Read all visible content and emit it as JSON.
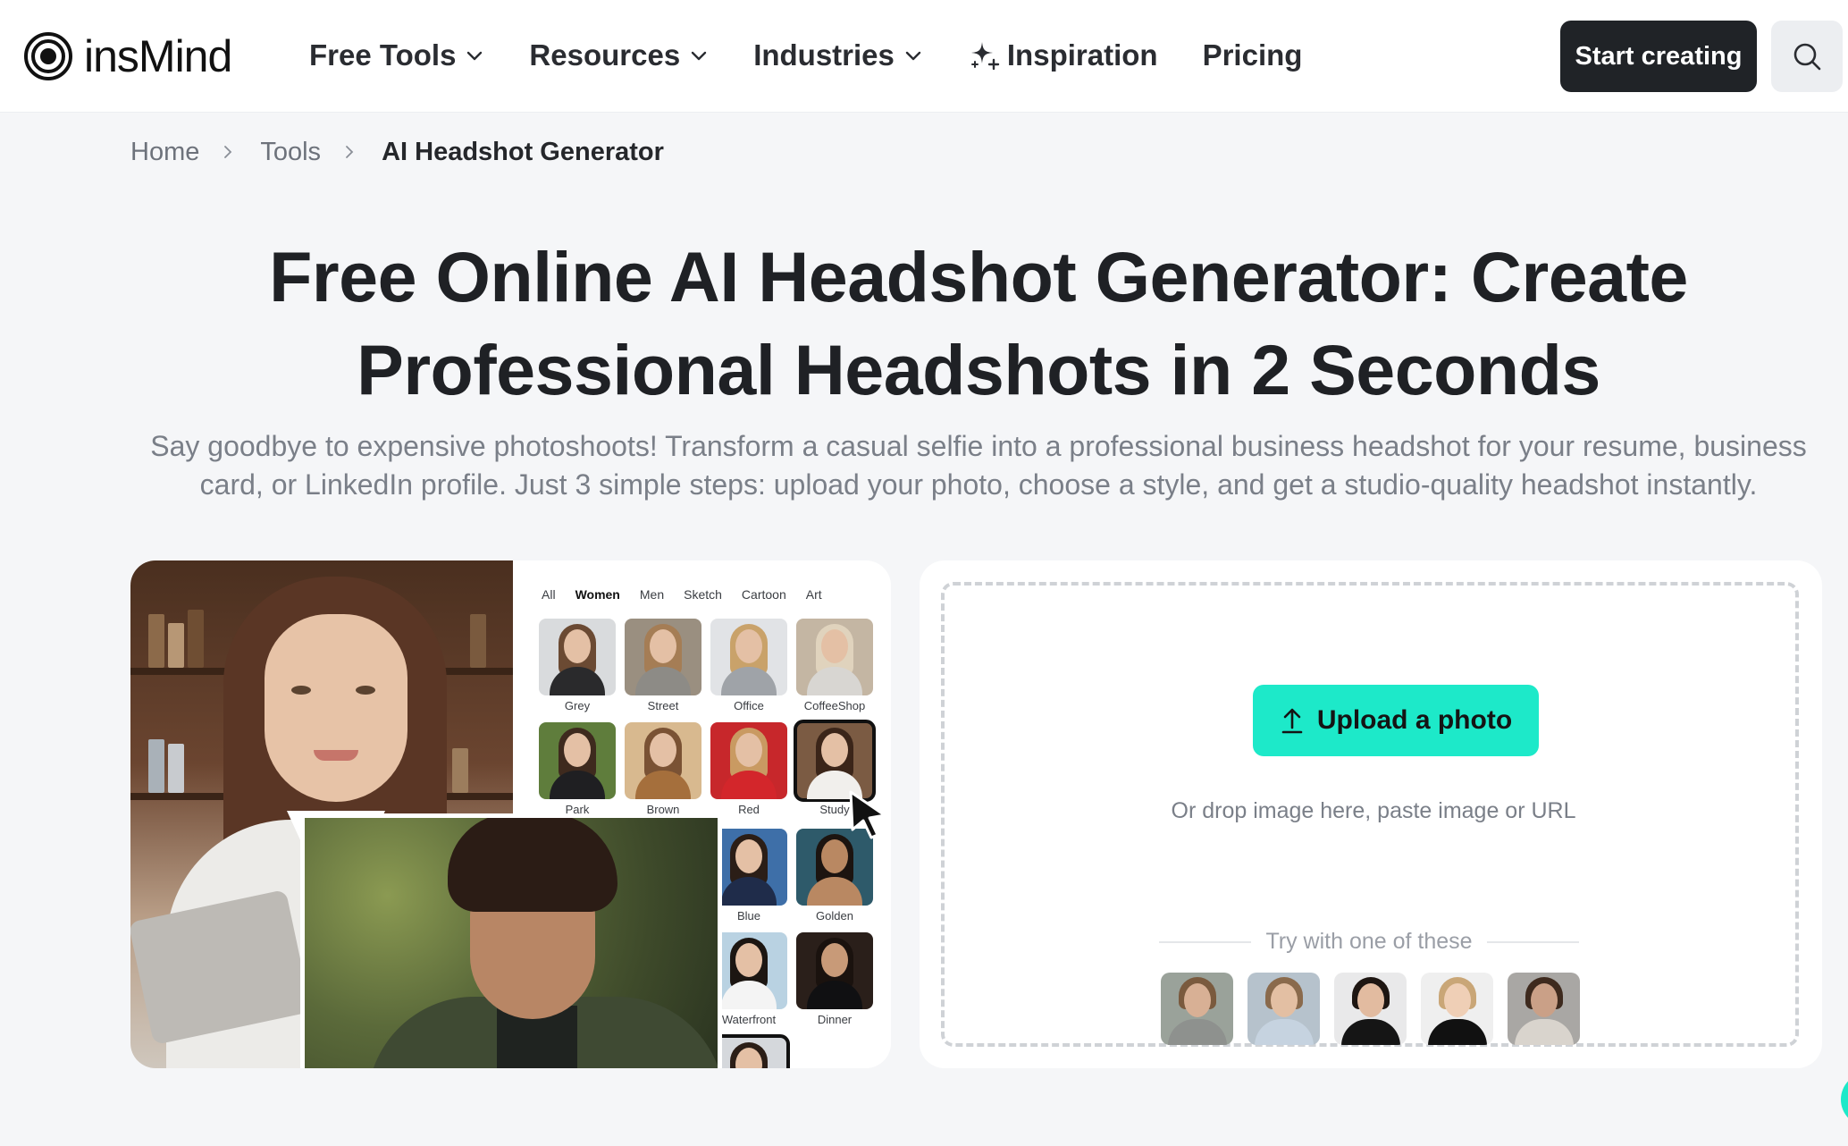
{
  "header": {
    "logo_text": "insMind",
    "nav": [
      {
        "label": "Free Tools",
        "dropdown": true
      },
      {
        "label": "Resources",
        "dropdown": true
      },
      {
        "label": "Industries",
        "dropdown": true
      },
      {
        "label": "Inspiration",
        "icon": "sparkle-icon"
      },
      {
        "label": "Pricing"
      }
    ],
    "start_label": "Start creating",
    "search_icon": "search-icon"
  },
  "breadcrumb": {
    "items": [
      "Home",
      "Tools"
    ],
    "current": "AI Headshot Generator"
  },
  "hero": {
    "title_line1": "Free Online AI Headshot Generator: Create",
    "title_line2": "Professional Headshots in 2 Seconds",
    "subtitle_line1": "Say goodbye to expensive photoshoots! Transform a casual selfie into a professional business headshot for your resume, business",
    "subtitle_line2": "card, or LinkedIn profile. Just 3 simple steps: upload your photo, choose a style, and get a studio-quality headshot instantly."
  },
  "showcase": {
    "tabs": [
      "All",
      "Women",
      "Men",
      "Sketch",
      "Cartoon",
      "Art"
    ],
    "active_tab": "Women",
    "styles": [
      "Grey",
      "Street",
      "Office",
      "CoffeeShop",
      "Park",
      "Brown",
      "Red",
      "Study",
      "Blue",
      "Golden",
      "Waterfront",
      "Dinner"
    ],
    "selected_style": "Study"
  },
  "upload": {
    "button_label": "Upload a photo",
    "hint": "Or drop image here, paste image or URL",
    "try_label": "Try with one of these"
  },
  "colors": {
    "accent": "#1de9c9",
    "dark_button": "#202327",
    "background": "#f5f6f8"
  }
}
